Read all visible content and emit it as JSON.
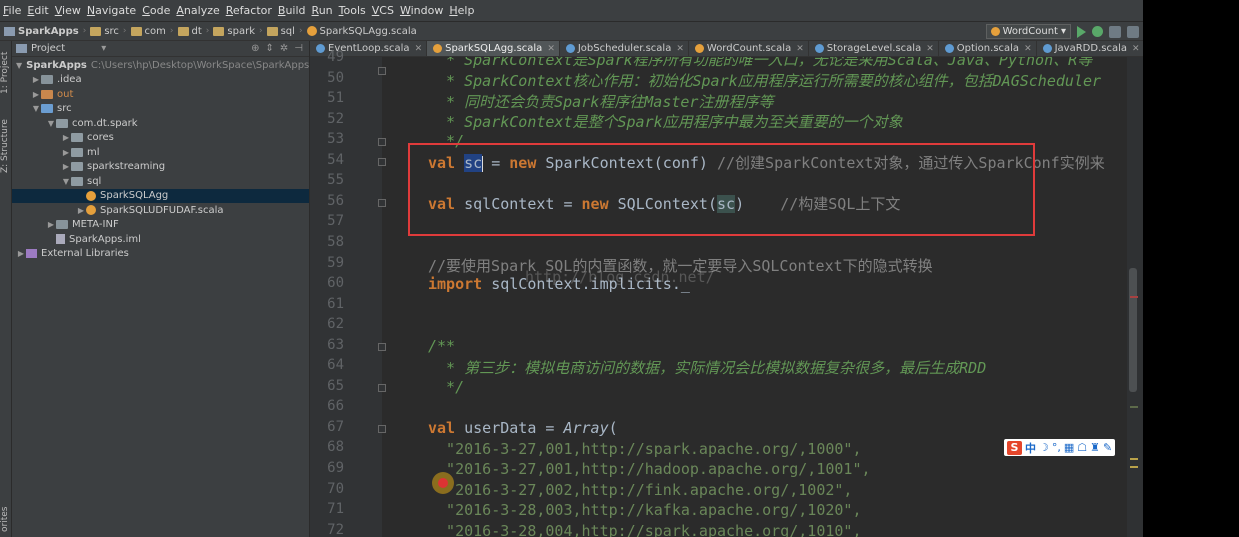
{
  "menu": [
    "File",
    "Edit",
    "View",
    "Navigate",
    "Code",
    "Analyze",
    "Refactor",
    "Build",
    "Run",
    "Tools",
    "VCS",
    "Window",
    "Help"
  ],
  "breadcrumb": [
    "SparkApps",
    "src",
    "com",
    "dt",
    "spark",
    "sql",
    "SparkSQLAgg.scala"
  ],
  "run_config": "WordCount",
  "side_tabs": {
    "project": "1: Project",
    "structure": "Z: Structure",
    "favorites": "orites"
  },
  "project_panel": {
    "header": "Project",
    "tree": [
      {
        "label": "SparkApps",
        "path": "C:\\Users\\hp\\Desktop\\WorkSpace\\SparkApps",
        "indent": 0,
        "kind": "root",
        "arrow": "▼"
      },
      {
        "label": ".idea",
        "indent": 1,
        "kind": "folder",
        "arrow": "▶"
      },
      {
        "label": "out",
        "indent": 1,
        "kind": "folder-orange",
        "arrow": "▶"
      },
      {
        "label": "src",
        "indent": 1,
        "kind": "folder-blue",
        "arrow": "▼"
      },
      {
        "label": "com.dt.spark",
        "indent": 2,
        "kind": "pkg",
        "arrow": "▼"
      },
      {
        "label": "cores",
        "indent": 3,
        "kind": "pkg",
        "arrow": "▶"
      },
      {
        "label": "ml",
        "indent": 3,
        "kind": "pkg",
        "arrow": "▶"
      },
      {
        "label": "sparkstreaming",
        "indent": 3,
        "kind": "pkg",
        "arrow": "▶"
      },
      {
        "label": "sql",
        "indent": 3,
        "kind": "pkg",
        "arrow": "▼"
      },
      {
        "label": "SparkSQLAgg",
        "indent": 4,
        "kind": "class",
        "arrow": "",
        "selected": true
      },
      {
        "label": "SparkSQLUDFUDAF.scala",
        "indent": 4,
        "kind": "class",
        "arrow": "▶"
      },
      {
        "label": "META-INF",
        "indent": 2,
        "kind": "folder",
        "arrow": "▶"
      },
      {
        "label": "SparkApps.iml",
        "indent": 2,
        "kind": "iml",
        "arrow": ""
      },
      {
        "label": "External Libraries",
        "indent": 0,
        "kind": "lib",
        "arrow": "▶"
      }
    ]
  },
  "tabs": [
    {
      "label": "EventLoop.scala",
      "active": false,
      "kind": "c"
    },
    {
      "label": "SparkSQLAgg.scala",
      "active": true,
      "kind": "o"
    },
    {
      "label": "JobScheduler.scala",
      "active": false,
      "kind": "c"
    },
    {
      "label": "WordCount.scala",
      "active": false,
      "kind": "o"
    },
    {
      "label": "StorageLevel.scala",
      "active": false,
      "kind": "c"
    },
    {
      "label": "Option.scala",
      "active": false,
      "kind": "c"
    },
    {
      "label": "JavaRDD.scala",
      "active": false,
      "kind": "c"
    }
  ],
  "line_numbers": [
    "49",
    "50",
    "51",
    "52",
    "53",
    "54",
    "55",
    "56",
    "57",
    "58",
    "59",
    "60",
    "61",
    "62",
    "63",
    "64",
    "65",
    "66",
    "67",
    "68",
    "69",
    "70",
    "71",
    "72"
  ],
  "code": {
    "l49": "  * SparkContext是Spark程序所有功能的唯一入口，无论是采用Scala、Java、Python、R等",
    "l50": "  * SparkContext核心作用：初始化Spark应用程序运行所需要的核心组件，包括DAGScheduler",
    "l51": "  * 同时还会负责Spark程序往Master注册程序等",
    "l52": "  * SparkContext是整个Spark应用程序中最为至关重要的一个对象",
    "l53": "  */",
    "l54_kw": "val",
    "l54_var": "sc",
    "l54_eq": " = ",
    "l54_new": "new",
    "l54_rest": " SparkContext(conf) ",
    "l54_cmt": "//创建SparkContext对象，通过传入SparkConf实例来",
    "l56_kw": "val",
    "l56_mid": " sqlContext = ",
    "l56_new": "new",
    "l56_call": " SQLContext(",
    "l56_arg": "sc",
    "l56_close": ")",
    "l56_cmt": "    //构建SQL上下文",
    "l59": "//要使用Spark SQL的内置函数，就一定要导入SQLContext下的隐式转换",
    "l60_kw": "import",
    "l60_rest": " sqlContext.implicits._",
    "l63": "/**",
    "l64": "  * 第三步：模拟电商访问的数据，实际情况会比模拟数据复杂很多，最后生成RDD",
    "l65": "  */",
    "l67_kw": "val",
    "l67_mid": " userData = ",
    "l67_arr": "Array",
    "l67_open": "(",
    "l68": "  \"2016-3-27,001,http://spark.apache.org/,1000\",",
    "l69": "  \"2016-3-27,001,http://hadoop.apache.org/,1001\",",
    "l70": "  \"2016-3-27,002,http://fink.apache.org/,1002\",",
    "l71": "  \"2016-3-28,003,http://kafka.apache.org/,1020\",",
    "l72": "  \"2016-3-28,004,http://spark.apache.org/,1010\","
  },
  "watermark": "http://blog.csdn.net/",
  "ime": {
    "logo": "S",
    "lang": "中"
  }
}
